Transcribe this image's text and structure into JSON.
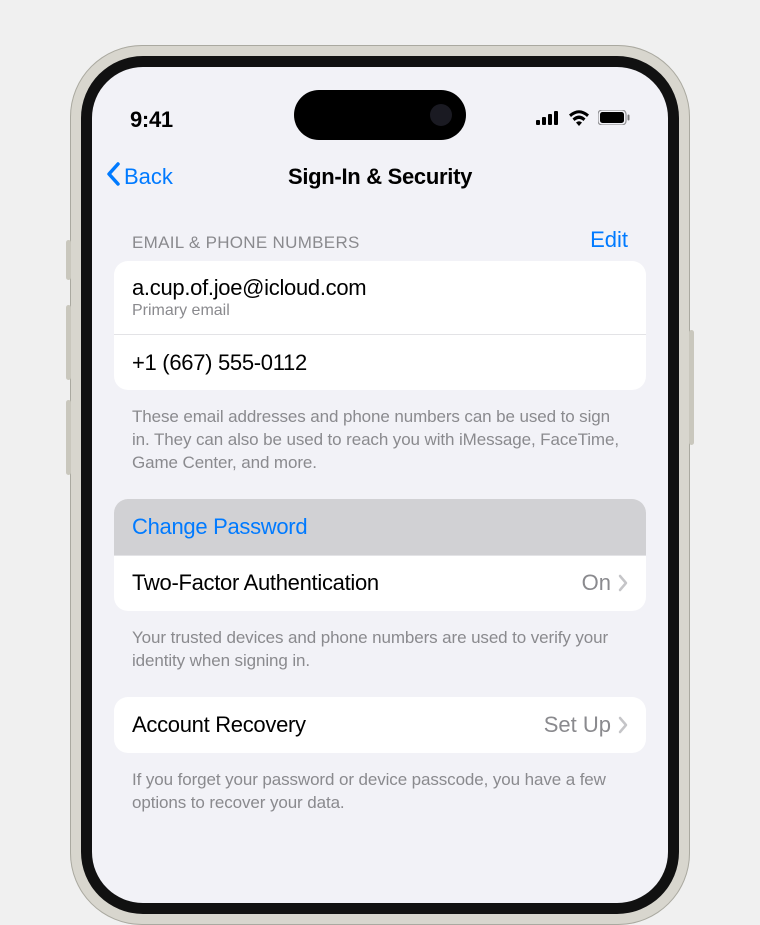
{
  "statusBar": {
    "time": "9:41"
  },
  "nav": {
    "back": "Back",
    "title": "Sign-In & Security"
  },
  "section1": {
    "header": "EMAIL & PHONE NUMBERS",
    "edit": "Edit",
    "email": "a.cup.of.joe@icloud.com",
    "emailSub": "Primary email",
    "phone": "+1 (667) 555-0112",
    "footer": "These email addresses and phone numbers can be used to sign in. They can also be used to reach you with iMessage, FaceTime, Game Center, and more."
  },
  "section2": {
    "changePassword": "Change Password",
    "twoFactor": "Two-Factor Authentication",
    "twoFactorValue": "On",
    "footer": "Your trusted devices and phone numbers are used to verify your identity when signing in."
  },
  "section3": {
    "recovery": "Account Recovery",
    "recoveryValue": "Set Up",
    "footer": "If you forget your password or device passcode, you have a few options to recover your data."
  }
}
